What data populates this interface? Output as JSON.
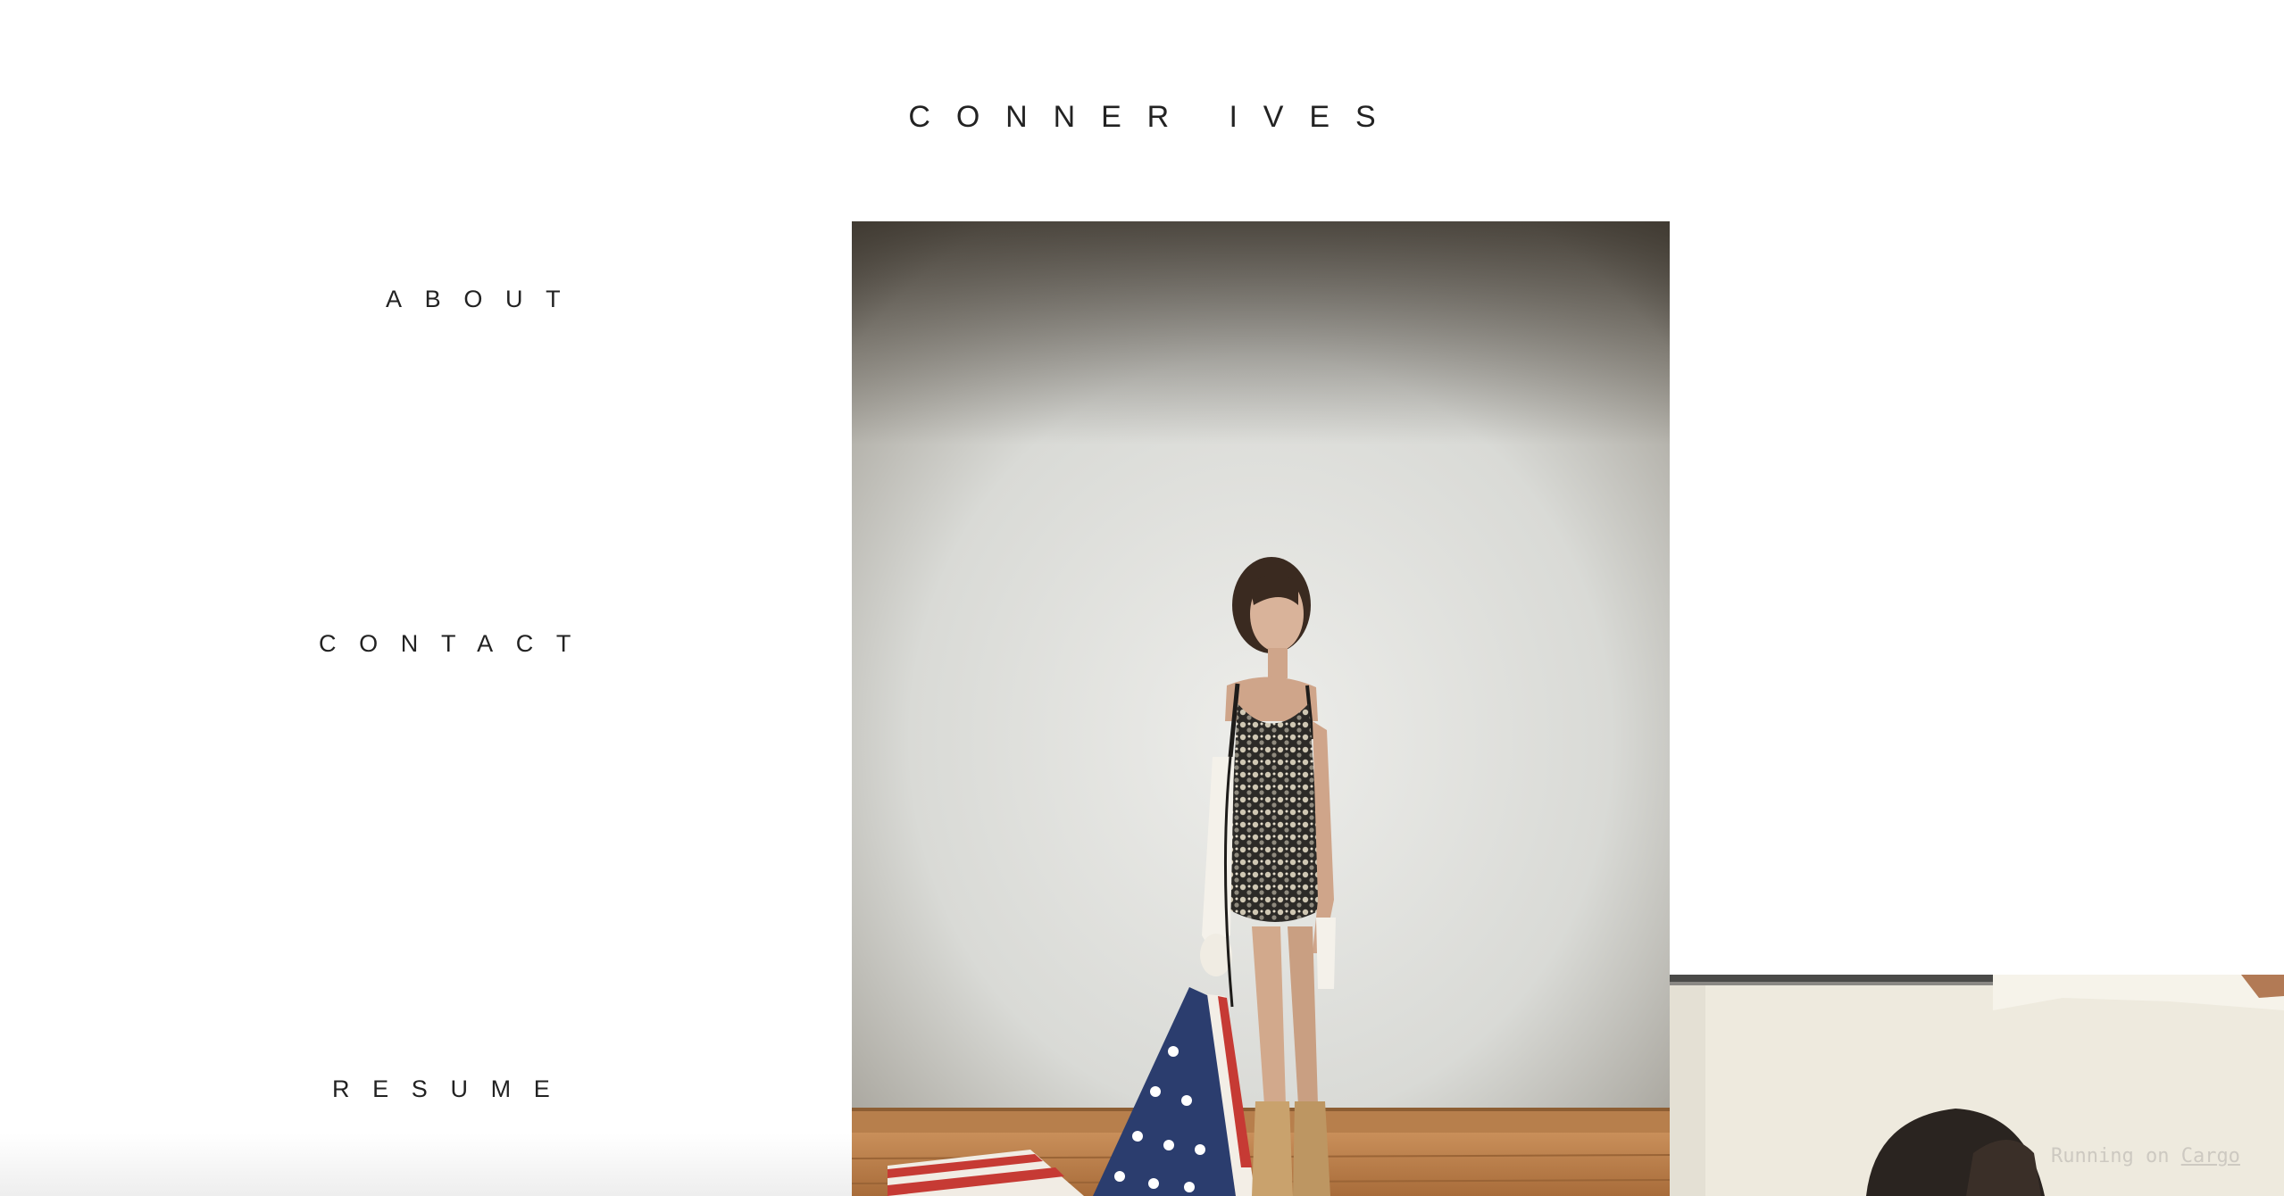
{
  "site": {
    "title": "CONNER IVES"
  },
  "nav": {
    "about": "ABOUT",
    "contact": "CONTACT",
    "resume": "RESUME"
  },
  "footer": {
    "running_on": "Running on ",
    "cargo_link": "Cargo"
  },
  "colors": {
    "text": "#222222",
    "background": "#ffffff",
    "badge_text": "#cdc9c1"
  }
}
